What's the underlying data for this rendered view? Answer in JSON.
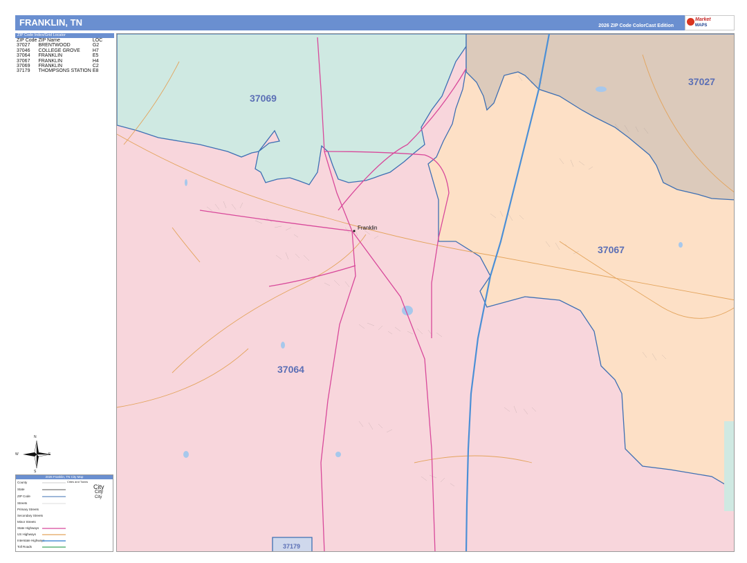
{
  "header": {
    "title": "FRANKLIN, TN",
    "edition": "2026 ZIP Code ColorCast Edition"
  },
  "logo": {
    "brand": "Market",
    "sub": "MAPS"
  },
  "locator": {
    "title": "ZIP Code Index/Grid Locator",
    "columns": [
      "ZIP Code",
      "ZIP Name",
      "LOC"
    ],
    "rows": [
      [
        "37027",
        "BRENTWOOD",
        "G2"
      ],
      [
        "37046",
        "COLLEGE GROVE",
        "H7"
      ],
      [
        "37064",
        "FRANKLIN",
        "E5"
      ],
      [
        "37067",
        "FRANKLIN",
        "H4"
      ],
      [
        "37069",
        "FRANKLIN",
        "C2"
      ],
      [
        "37179",
        "THOMPSONS STATION",
        "E8"
      ]
    ]
  },
  "map": {
    "zip_labels": [
      "37069",
      "37027",
      "37067",
      "37064",
      "37179"
    ],
    "city": "Franklin",
    "colors": {
      "zip_37064": "#f8d6dc",
      "zip_37067": "#fde0c6",
      "zip_37069": "#cfe9e2",
      "zip_37027": "#dccabb",
      "boundary": "#3d6fb3",
      "interstate": "#4b8fd6",
      "state_highway": "#d8489a",
      "primary_street": "#e3a35a"
    }
  },
  "compass": {
    "n": "N",
    "s": "S",
    "e": "E",
    "w": "W"
  },
  "legend": {
    "title": "2026 Franklin, TN City Map",
    "items": [
      "County",
      "State",
      "ZIP Code",
      "Streets",
      "Primary Streets",
      "Secondary Streets",
      "Minor Streets",
      "State Highways",
      "US Highways",
      "Interstate Highways",
      "Toll Roads"
    ],
    "cities_title": "Cities and Towns",
    "city_sizes": [
      "City",
      "City",
      "City"
    ]
  }
}
